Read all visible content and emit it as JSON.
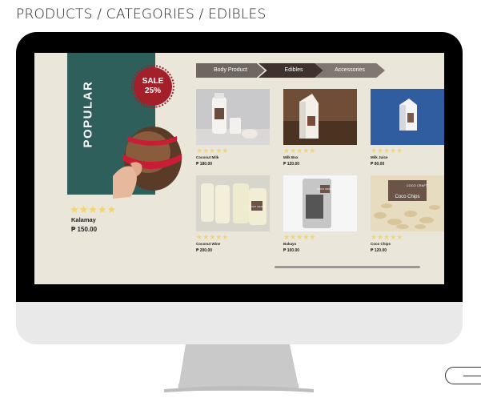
{
  "breadcrumb": {
    "text": "PRODUCTS / CATEGORIES / EDIBLES"
  },
  "hero": {
    "label": "POPULAR",
    "sale_line1": "SALE",
    "sale_line2": "25%",
    "stars": "★★★★★",
    "name": "Kalamay",
    "price": "₱ 150.00"
  },
  "tabs": [
    "Body Product",
    "Edibles",
    "Accessories"
  ],
  "products": [
    {
      "name": "Coconut Milk",
      "price": "₱ 180.00",
      "stars": "★★★★★",
      "icon": "milk-bottle-icon"
    },
    {
      "name": "Milk Box",
      "price": "₱ 120.00",
      "stars": "★★★★★",
      "icon": "milk-box-icon"
    },
    {
      "name": "Milk Juice",
      "price": "₱ 80.00",
      "stars": "★★★★★",
      "icon": "juice-carton-icon"
    },
    {
      "name": "Coconut Wine",
      "price": "₱ 200.00",
      "stars": "★★★★★",
      "icon": "wine-jar-icon",
      "label": "COCO CRAFT"
    },
    {
      "name": "Bukayo",
      "price": "₱ 100.00",
      "stars": "★★★★★",
      "icon": "snack-bag-icon",
      "label": "COCO CRAFT"
    },
    {
      "name": "Coco Chips",
      "price": "₱ 120.00",
      "stars": "★★★★★",
      "icon": "chips-icon",
      "label": "COCO CRAFT",
      "sublabel": "Coco Chips"
    }
  ],
  "colors": {
    "accent_green": "#2f5f5a",
    "sale_red": "#a3202a",
    "star": "#f2d56b",
    "screen_bg": "#eae6d9"
  }
}
